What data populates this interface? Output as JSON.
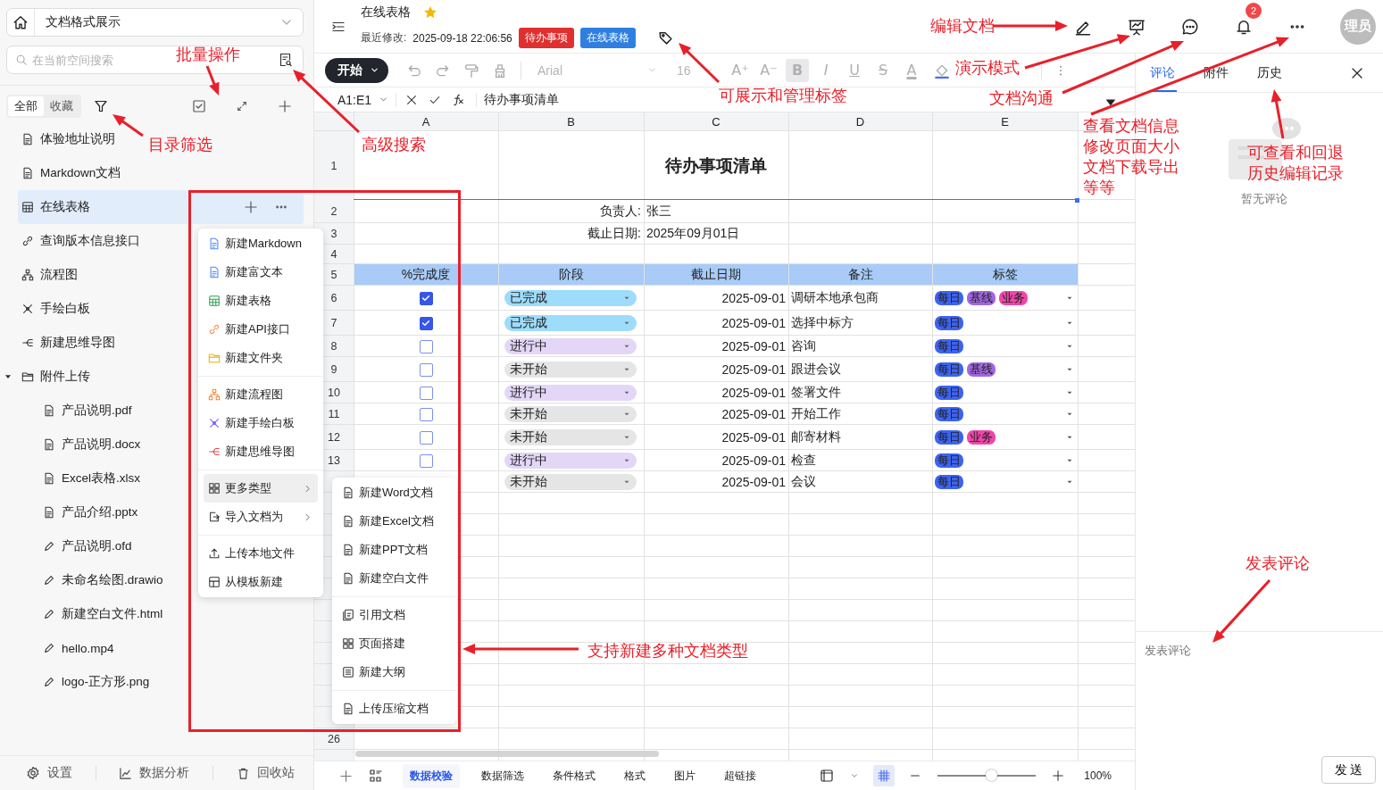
{
  "sidebar": {
    "space": {
      "title": "文档格式展示"
    },
    "search": {
      "placeholder": "在当前空间搜索"
    },
    "segments": [
      {
        "label": "全部",
        "selected": true
      },
      {
        "label": "收藏",
        "selected": false
      }
    ],
    "tree": [
      {
        "label": "体验地址说明",
        "selected": false
      },
      {
        "label": "Markdown文档",
        "selected": false
      },
      {
        "label": "在线表格",
        "selected": true
      },
      {
        "label": "查询版本信息接口",
        "selected": false
      },
      {
        "label": "流程图",
        "selected": false
      },
      {
        "label": "手绘白板",
        "selected": false
      },
      {
        "label": "新建思维导图",
        "selected": false
      },
      {
        "label": "附件上传",
        "selected": false,
        "expanded": true,
        "children": [
          {
            "label": "产品说明.pdf"
          },
          {
            "label": "产品说明.docx"
          },
          {
            "label": "Excel表格.xlsx"
          },
          {
            "label": "产品介绍.pptx"
          },
          {
            "label": "产品说明.ofd"
          },
          {
            "label": "未命名绘图.drawio"
          },
          {
            "label": "新建空白文件.html"
          },
          {
            "label": "hello.mp4"
          },
          {
            "label": "logo-正方形.png"
          }
        ]
      }
    ],
    "footer": [
      {
        "label": "设置"
      },
      {
        "label": "数据分析"
      },
      {
        "label": "回收站"
      }
    ]
  },
  "header": {
    "title": "在线表格",
    "starred": true,
    "modified_label": "最近修改:",
    "modified": "2025-09-18 22:06:56",
    "tags": [
      {
        "label": "待办事项",
        "color": "#e02f2f"
      },
      {
        "label": "在线表格",
        "color": "#2f7fe0"
      }
    ],
    "notifications": "2",
    "avatar": "理员"
  },
  "toolbar": {
    "start": "开始",
    "font": "Arial",
    "size": "16",
    "format_buttons": [
      {
        "label": "A⁺",
        "selected": false
      },
      {
        "label": "A⁻",
        "selected": false
      },
      {
        "label": "B",
        "selected": true
      },
      {
        "label": "I",
        "selected": false
      },
      {
        "label": "U",
        "selected": false
      },
      {
        "label": "S",
        "selected": false
      },
      {
        "label": "A",
        "selected": false
      }
    ]
  },
  "formula": {
    "cell": "A1:E1",
    "content": "待办事项清单"
  },
  "sheet": {
    "columns": [
      "A",
      "B",
      "C",
      "D",
      "E"
    ],
    "top_row_numbers": [
      "1",
      "2",
      "3",
      "4",
      "5"
    ],
    "title": "待办事项清单",
    "owner_label": "负责人:",
    "owner": "张三",
    "due_label": "截止日期:",
    "due": "2025年09月01日",
    "headers": [
      "%完成度",
      "阶段",
      "截止日期",
      "备注",
      "标签"
    ],
    "rows": [
      {
        "num": "6",
        "done": true,
        "stage": "已完成",
        "kind": "done",
        "date": "2025-09-01",
        "note": "调研本地承包商",
        "tags": [
          {
            "label": "每日",
            "color": "#3d63f0"
          },
          {
            "label": "基线",
            "color": "#a267e0"
          },
          {
            "label": "业务",
            "color": "#ee47a8"
          }
        ]
      },
      {
        "num": "7",
        "done": true,
        "stage": "已完成",
        "kind": "done",
        "date": "2025-09-01",
        "note": "选择中标方",
        "tags": [
          {
            "label": "每日",
            "color": "#3d63f0"
          }
        ]
      },
      {
        "num": "8",
        "done": false,
        "stage": "进行中",
        "kind": "doing",
        "date": "2025-09-01",
        "note": "咨询",
        "tags": [
          {
            "label": "每日",
            "color": "#3d63f0"
          }
        ]
      },
      {
        "num": "9",
        "done": false,
        "stage": "未开始",
        "kind": "todo",
        "date": "2025-09-01",
        "note": "跟进会议",
        "tags": [
          {
            "label": "每日",
            "color": "#3d63f0"
          },
          {
            "label": "基线",
            "color": "#a267e0"
          }
        ]
      },
      {
        "num": "10",
        "done": false,
        "stage": "进行中",
        "kind": "doing",
        "date": "2025-09-01",
        "note": "签署文件",
        "tags": [
          {
            "label": "每日",
            "color": "#3d63f0"
          }
        ]
      },
      {
        "num": "11",
        "done": false,
        "stage": "未开始",
        "kind": "todo",
        "date": "2025-09-01",
        "note": "开始工作",
        "tags": [
          {
            "label": "每日",
            "color": "#3d63f0"
          }
        ]
      },
      {
        "num": "12",
        "done": false,
        "stage": "未开始",
        "kind": "todo",
        "date": "2025-09-01",
        "note": "邮寄材料",
        "tags": [
          {
            "label": "每日",
            "color": "#3d63f0"
          },
          {
            "label": "业务",
            "color": "#ee47a8"
          }
        ]
      },
      {
        "num": "13",
        "done": false,
        "stage": "进行中",
        "kind": "doing",
        "date": "2025-09-01",
        "note": "检查",
        "tags": [
          {
            "label": "每日",
            "color": "#3d63f0"
          }
        ]
      },
      {
        "stage": "未开始",
        "kind": "todo",
        "date": "2025-09-01",
        "note": "会议",
        "tags": [
          {
            "label": "每日",
            "color": "#3d63f0"
          }
        ]
      }
    ],
    "bottom_row_number": "26",
    "sheet_tabs": [
      {
        "label": "数据校验",
        "selected": true
      },
      {
        "label": "数据筛选",
        "selected": false
      },
      {
        "label": "条件格式",
        "selected": false
      },
      {
        "label": "格式",
        "selected": false
      },
      {
        "label": "图片",
        "selected": false
      },
      {
        "label": "超链接",
        "selected": false
      }
    ],
    "zoom": {
      "level": 0.55,
      "reading": "100%"
    }
  },
  "context_menu": {
    "groups": [
      {
        "items": [
          {
            "label": "新建Markdown"
          },
          {
            "label": "新建富文本"
          },
          {
            "label": "新建表格"
          },
          {
            "label": "新建API接口"
          },
          {
            "label": "新建文件夹"
          }
        ]
      },
      {
        "items": [
          {
            "label": "新建流程图"
          },
          {
            "label": "新建手绘白板"
          },
          {
            "label": "新建思维导图"
          }
        ]
      },
      {
        "items": [
          {
            "label": "更多类型",
            "submenu": true,
            "selected": true
          },
          {
            "label": "导入文档为",
            "submenu": true,
            "selected": false
          }
        ]
      },
      {
        "items": [
          {
            "label": "上传本地文件"
          },
          {
            "label": "从模板新建"
          }
        ]
      }
    ]
  },
  "submenu": {
    "groups": [
      {
        "items": [
          {
            "label": "新建Word文档"
          },
          {
            "label": "新建Excel文档"
          },
          {
            "label": "新建PPT文档"
          },
          {
            "label": "新建空白文件"
          }
        ]
      },
      {
        "items": [
          {
            "label": "引用文档"
          },
          {
            "label": "页面搭建"
          },
          {
            "label": "新建大纲"
          }
        ]
      },
      {
        "items": [
          {
            "label": "上传压缩文档"
          }
        ]
      }
    ]
  },
  "right_panel": {
    "tabs": [
      {
        "label": "评论",
        "selected": true
      },
      {
        "label": "附件",
        "selected": false
      },
      {
        "label": "历史",
        "selected": false
      }
    ],
    "empty": "暂无评论",
    "comment_placeholder": "发表评论",
    "send": "发 送"
  },
  "annotations": [
    {
      "text": "批量操作"
    },
    {
      "text": "目录筛选"
    },
    {
      "text": "高级搜索"
    },
    {
      "text": "编辑文档"
    },
    {
      "text": "演示模式"
    },
    {
      "text": "可展示和管理标签"
    },
    {
      "text": "文档沟通"
    },
    {
      "text": "查看文档信息修改页面大小文档下载导出等等"
    },
    {
      "text": "可查看和回退历史编辑记录"
    },
    {
      "text": "发表评论"
    },
    {
      "text": "支持新建多种文档类型"
    }
  ]
}
